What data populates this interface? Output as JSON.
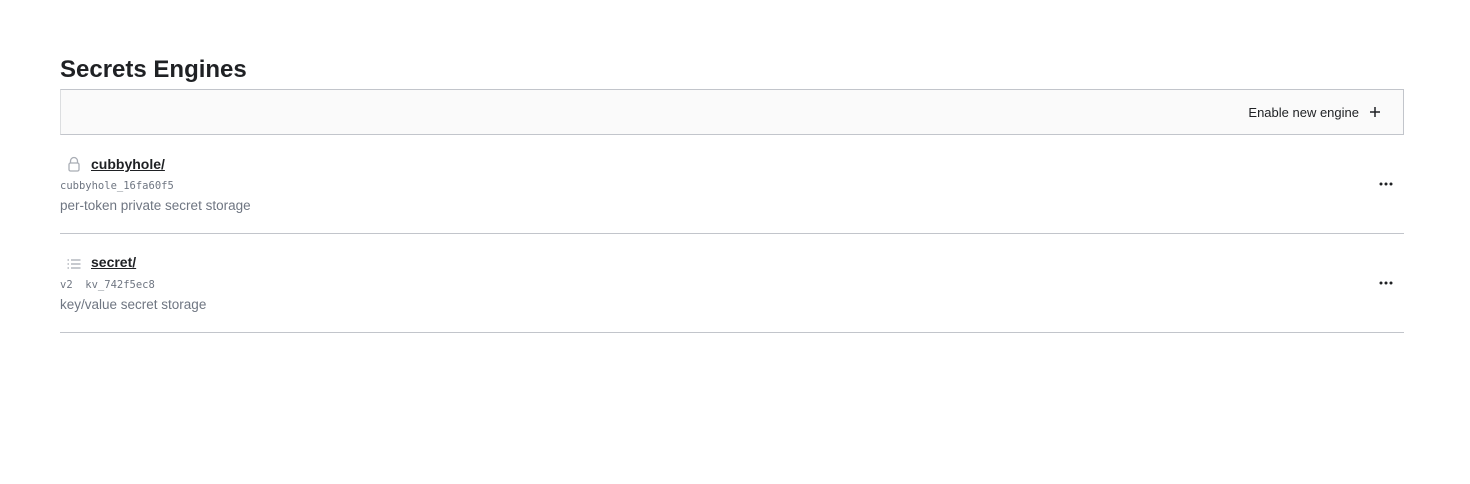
{
  "page": {
    "title": "Secrets Engines"
  },
  "toolbar": {
    "enable_label": "Enable new engine",
    "enable_icon": "plus-icon"
  },
  "engines": [
    {
      "path": "cubbyhole/",
      "meta": "cubbyhole_16fa60f5",
      "description": "per-token private secret storage",
      "icon": "lock-icon",
      "menu_icon": "more-horizontal-icon"
    },
    {
      "path": "secret/",
      "meta": "v2  kv_742f5ec8",
      "description": "key/value secret storage",
      "icon": "list-icon",
      "menu_icon": "more-horizontal-icon"
    }
  ],
  "colors": {
    "text": "#1f2124",
    "muted": "#6f7682",
    "border": "#c2c5cb",
    "toolbar_bg": "#fafafa",
    "icon_gray": "#a9adb5"
  }
}
